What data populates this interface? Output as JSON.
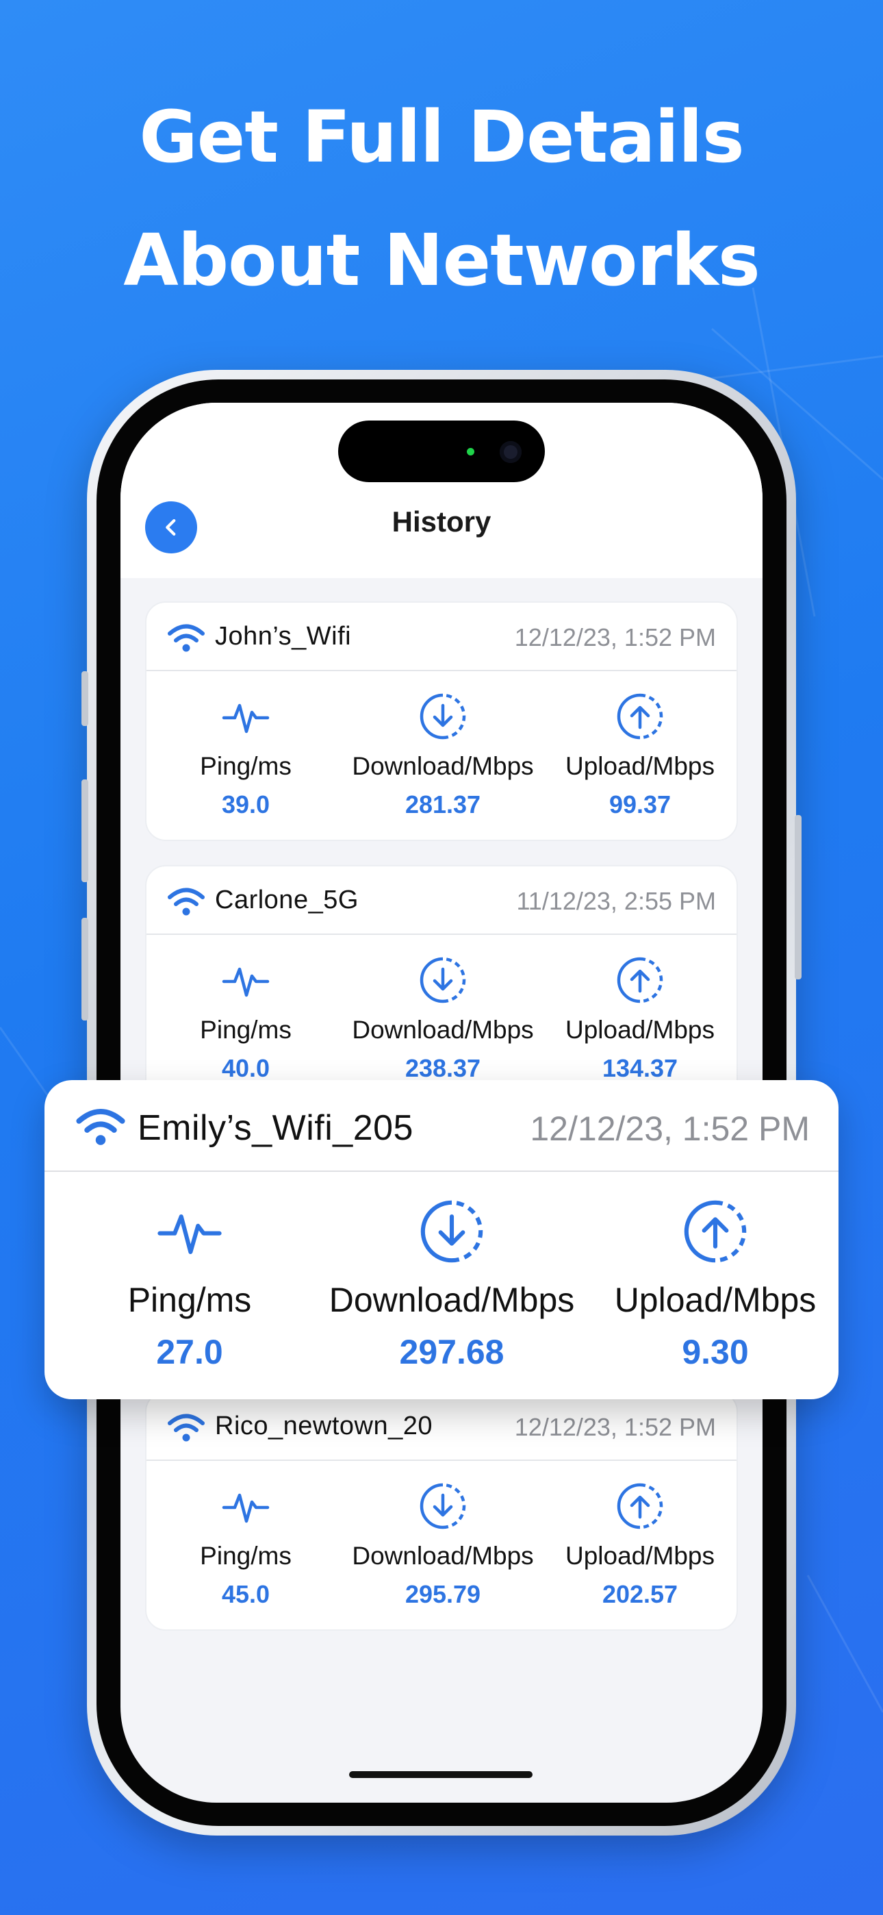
{
  "promo": {
    "headline_line1": "Get Full Details",
    "headline_line2": "About Networks"
  },
  "screen": {
    "title": "History",
    "back_icon": "chevron-left-icon"
  },
  "records": [
    {
      "network": "John’s_Wifi",
      "timestamp": "12/12/23,  1:52 PM",
      "ping_label": "Ping/ms",
      "ping": "39.0",
      "download_label": "Download/Mbps",
      "download": "281.37",
      "upload_label": "Upload/Mbps",
      "upload": "99.37"
    },
    {
      "network": "Carlone_5G",
      "timestamp": "11/12/23,  2:55 PM",
      "ping_label": "Ping/ms",
      "ping": "40.0",
      "download_label": "Download/Mbps",
      "download": "238.37",
      "upload_label": "Upload/Mbps",
      "upload": "134.37"
    },
    {
      "network": "Rico_newtown_20",
      "timestamp": "12/12/23,  1:52 PM",
      "ping_label": "Ping/ms",
      "ping": "45.0",
      "download_label": "Download/Mbps",
      "download": "295.79",
      "upload_label": "Upload/Mbps",
      "upload": "202.57"
    }
  ],
  "highlight": {
    "network": "Emily’s_Wifi_205",
    "timestamp": "12/12/23,  1:52 PM",
    "ping_label": "Ping/ms",
    "ping": "27.0",
    "download_label": "Download/Mbps",
    "download": "297.68",
    "upload_label": "Upload/Mbps",
    "upload": "9.30"
  },
  "colors": {
    "background": "#1f7bf1",
    "accent": "#2d74e2",
    "value_text": "#2d74e2",
    "muted_text": "#8e9096"
  },
  "icons": {
    "network": "wifi-icon",
    "ping": "pulse-icon",
    "download": "download-circle-icon",
    "upload": "upload-circle-icon"
  }
}
